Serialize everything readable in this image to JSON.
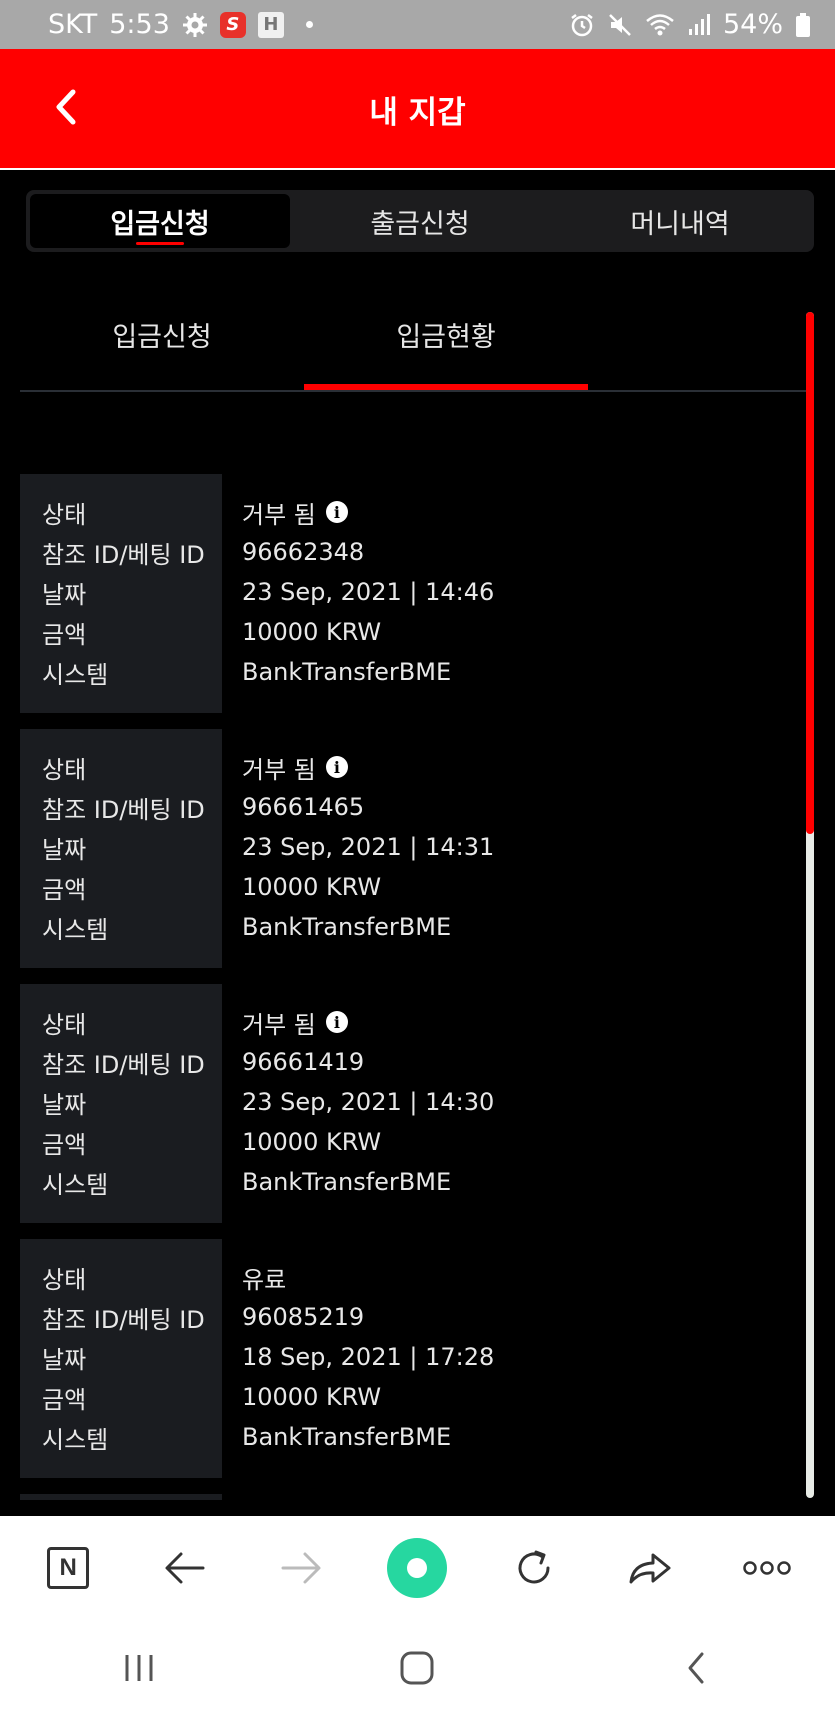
{
  "status_bar": {
    "carrier": "SKT",
    "time": "5:53",
    "battery": "54%",
    "icons_left": [
      "settings-gear-icon",
      "app-s-icon",
      "app-h-icon",
      "notification-dot-icon"
    ],
    "icons_right": [
      "alarm-icon",
      "mute-icon",
      "wifi-icon",
      "signal-icon",
      "battery-icon"
    ]
  },
  "header": {
    "title": "내 지갑",
    "back_icon": "chevron-left-icon",
    "background": "#ff0000"
  },
  "segment_tabs": {
    "items": [
      {
        "label": "입금신청",
        "active": true
      },
      {
        "label": "출금신청",
        "active": false
      },
      {
        "label": "머니내역",
        "active": false
      }
    ]
  },
  "sub_tabs": {
    "items": [
      {
        "label": "입금신청",
        "active": false
      },
      {
        "label": "입금현황",
        "active": true
      }
    ]
  },
  "labels": {
    "status": "상태",
    "ref_id": "참조 ID/베팅 ID",
    "date": "날짜",
    "amount": "금액",
    "system": "시스템"
  },
  "records": [
    {
      "status": "거부 됨",
      "status_info": true,
      "ref_id": "96662348",
      "date": "23 Sep, 2021 | 14:46",
      "amount": "10000 KRW",
      "system": "BankTransferBME"
    },
    {
      "status": "거부 됨",
      "status_info": true,
      "ref_id": "96661465",
      "date": "23 Sep, 2021 | 14:31",
      "amount": "10000 KRW",
      "system": "BankTransferBME"
    },
    {
      "status": "거부 됨",
      "status_info": true,
      "ref_id": "96661419",
      "date": "23 Sep, 2021 | 14:30",
      "amount": "10000 KRW",
      "system": "BankTransferBME"
    },
    {
      "status": "유료",
      "status_info": false,
      "ref_id": "96085219",
      "date": "18 Sep, 2021 | 17:28",
      "amount": "10000 KRW",
      "system": "BankTransferBME"
    }
  ],
  "scroll": {
    "position_fraction": 0.0,
    "visible_fraction": 0.44
  },
  "browser_toolbar": {
    "items": [
      "naver-n-icon",
      "back-arrow-icon",
      "forward-arrow-icon",
      "home-icon",
      "refresh-icon",
      "share-icon",
      "more-icon"
    ],
    "n_label": "N"
  },
  "colors": {
    "accent": "#ff0000",
    "panel": "#1a1c20",
    "home_button": "#26d7a0"
  }
}
